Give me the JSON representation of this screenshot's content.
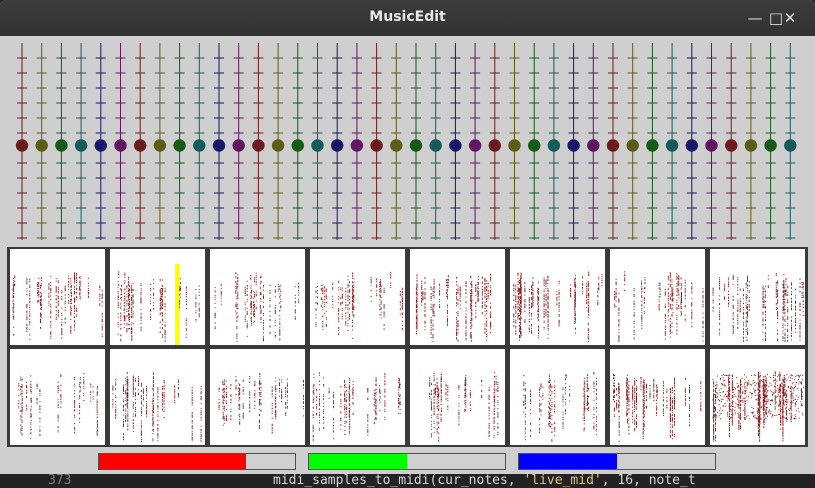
{
  "window": {
    "title": "MusicEdit",
    "minimize_glyph": "—",
    "maximize_glyph": "□",
    "close_glyph": "✕"
  },
  "background_code": {
    "line_number": "373",
    "code_prefix": "midi_samples_to_midi(cur_notes, ",
    "code_string": "'live_mid'",
    "code_suffix": ", 16, note_t"
  },
  "piano_roll": {
    "track_count": 40,
    "track_colors": [
      "#6b1b1b",
      "#5c5c16",
      "#155a15",
      "#145c5c",
      "#181866",
      "#601660"
    ],
    "note_level": 0.5,
    "background": "#cfcfcf"
  },
  "sample_grid": {
    "rows": 2,
    "columns": 8,
    "dot_color": "#8b1a1a",
    "cursor": {
      "row": 0,
      "column": 1,
      "color": "#ffff00"
    }
  },
  "level_bars": [
    {
      "name": "red",
      "color": "#ff0000",
      "level": 0.75
    },
    {
      "name": "green",
      "color": "#00ff00",
      "level": 0.5
    },
    {
      "name": "blue",
      "color": "#0000ff",
      "level": 0.5
    }
  ]
}
